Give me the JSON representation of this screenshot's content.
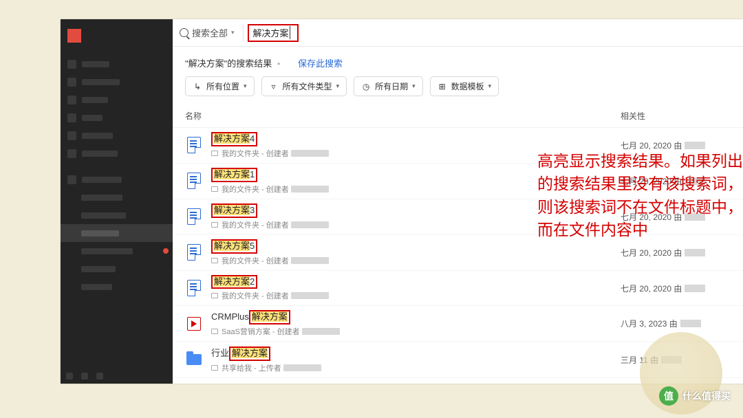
{
  "search": {
    "scope_label": "搜索全部",
    "query": "解决方案"
  },
  "results_header": {
    "prefix": "\"解决方案\"的搜索结果",
    "save_link": "保存此搜索"
  },
  "filters": {
    "location": "所有位置",
    "filetype": "所有文件类型",
    "date": "所有日期",
    "template": "数据模板"
  },
  "columns": {
    "name": "名称",
    "relevance": "相关性"
  },
  "results": [
    {
      "type": "doc",
      "highlight": "解决方案",
      "suffix": "4",
      "meta_folder": "我的文件夹 - 创建者",
      "rel": "七月 20, 2020 由"
    },
    {
      "type": "doc",
      "highlight": "解决方案",
      "suffix": "1",
      "meta_folder": "我的文件夹 - 创建者",
      "rel": "七月 20, 2020 由"
    },
    {
      "type": "doc",
      "highlight": "解决方案",
      "suffix": "3",
      "meta_folder": "我的文件夹 - 创建者",
      "rel": "七月 20, 2020 由"
    },
    {
      "type": "doc",
      "highlight": "解决方案",
      "suffix": "5",
      "meta_folder": "我的文件夹 - 创建者",
      "rel": "七月 20, 2020 由"
    },
    {
      "type": "doc",
      "highlight": "解决方案",
      "suffix": "2",
      "meta_folder": "我的文件夹 - 创建者",
      "rel": "七月 20, 2020 由"
    },
    {
      "type": "pres",
      "prefix": "CRMPlus",
      "highlight": "解决方案",
      "suffix": "",
      "meta_folder": "SaaS营销方案 - 创建者",
      "rel": "八月 3, 2023 由"
    },
    {
      "type": "folder",
      "prefix": "行业",
      "highlight": "解决方案",
      "suffix": "",
      "meta_folder": "共享给我 - 上传者",
      "rel": "三月 11 由"
    }
  ],
  "annotation": "高亮显示搜索结果。如果列出的搜索结果里没有该搜索词，则该搜索词不在文件标题中，而在文件内容中",
  "watermark": {
    "icon": "值",
    "text": "什么值得买"
  }
}
